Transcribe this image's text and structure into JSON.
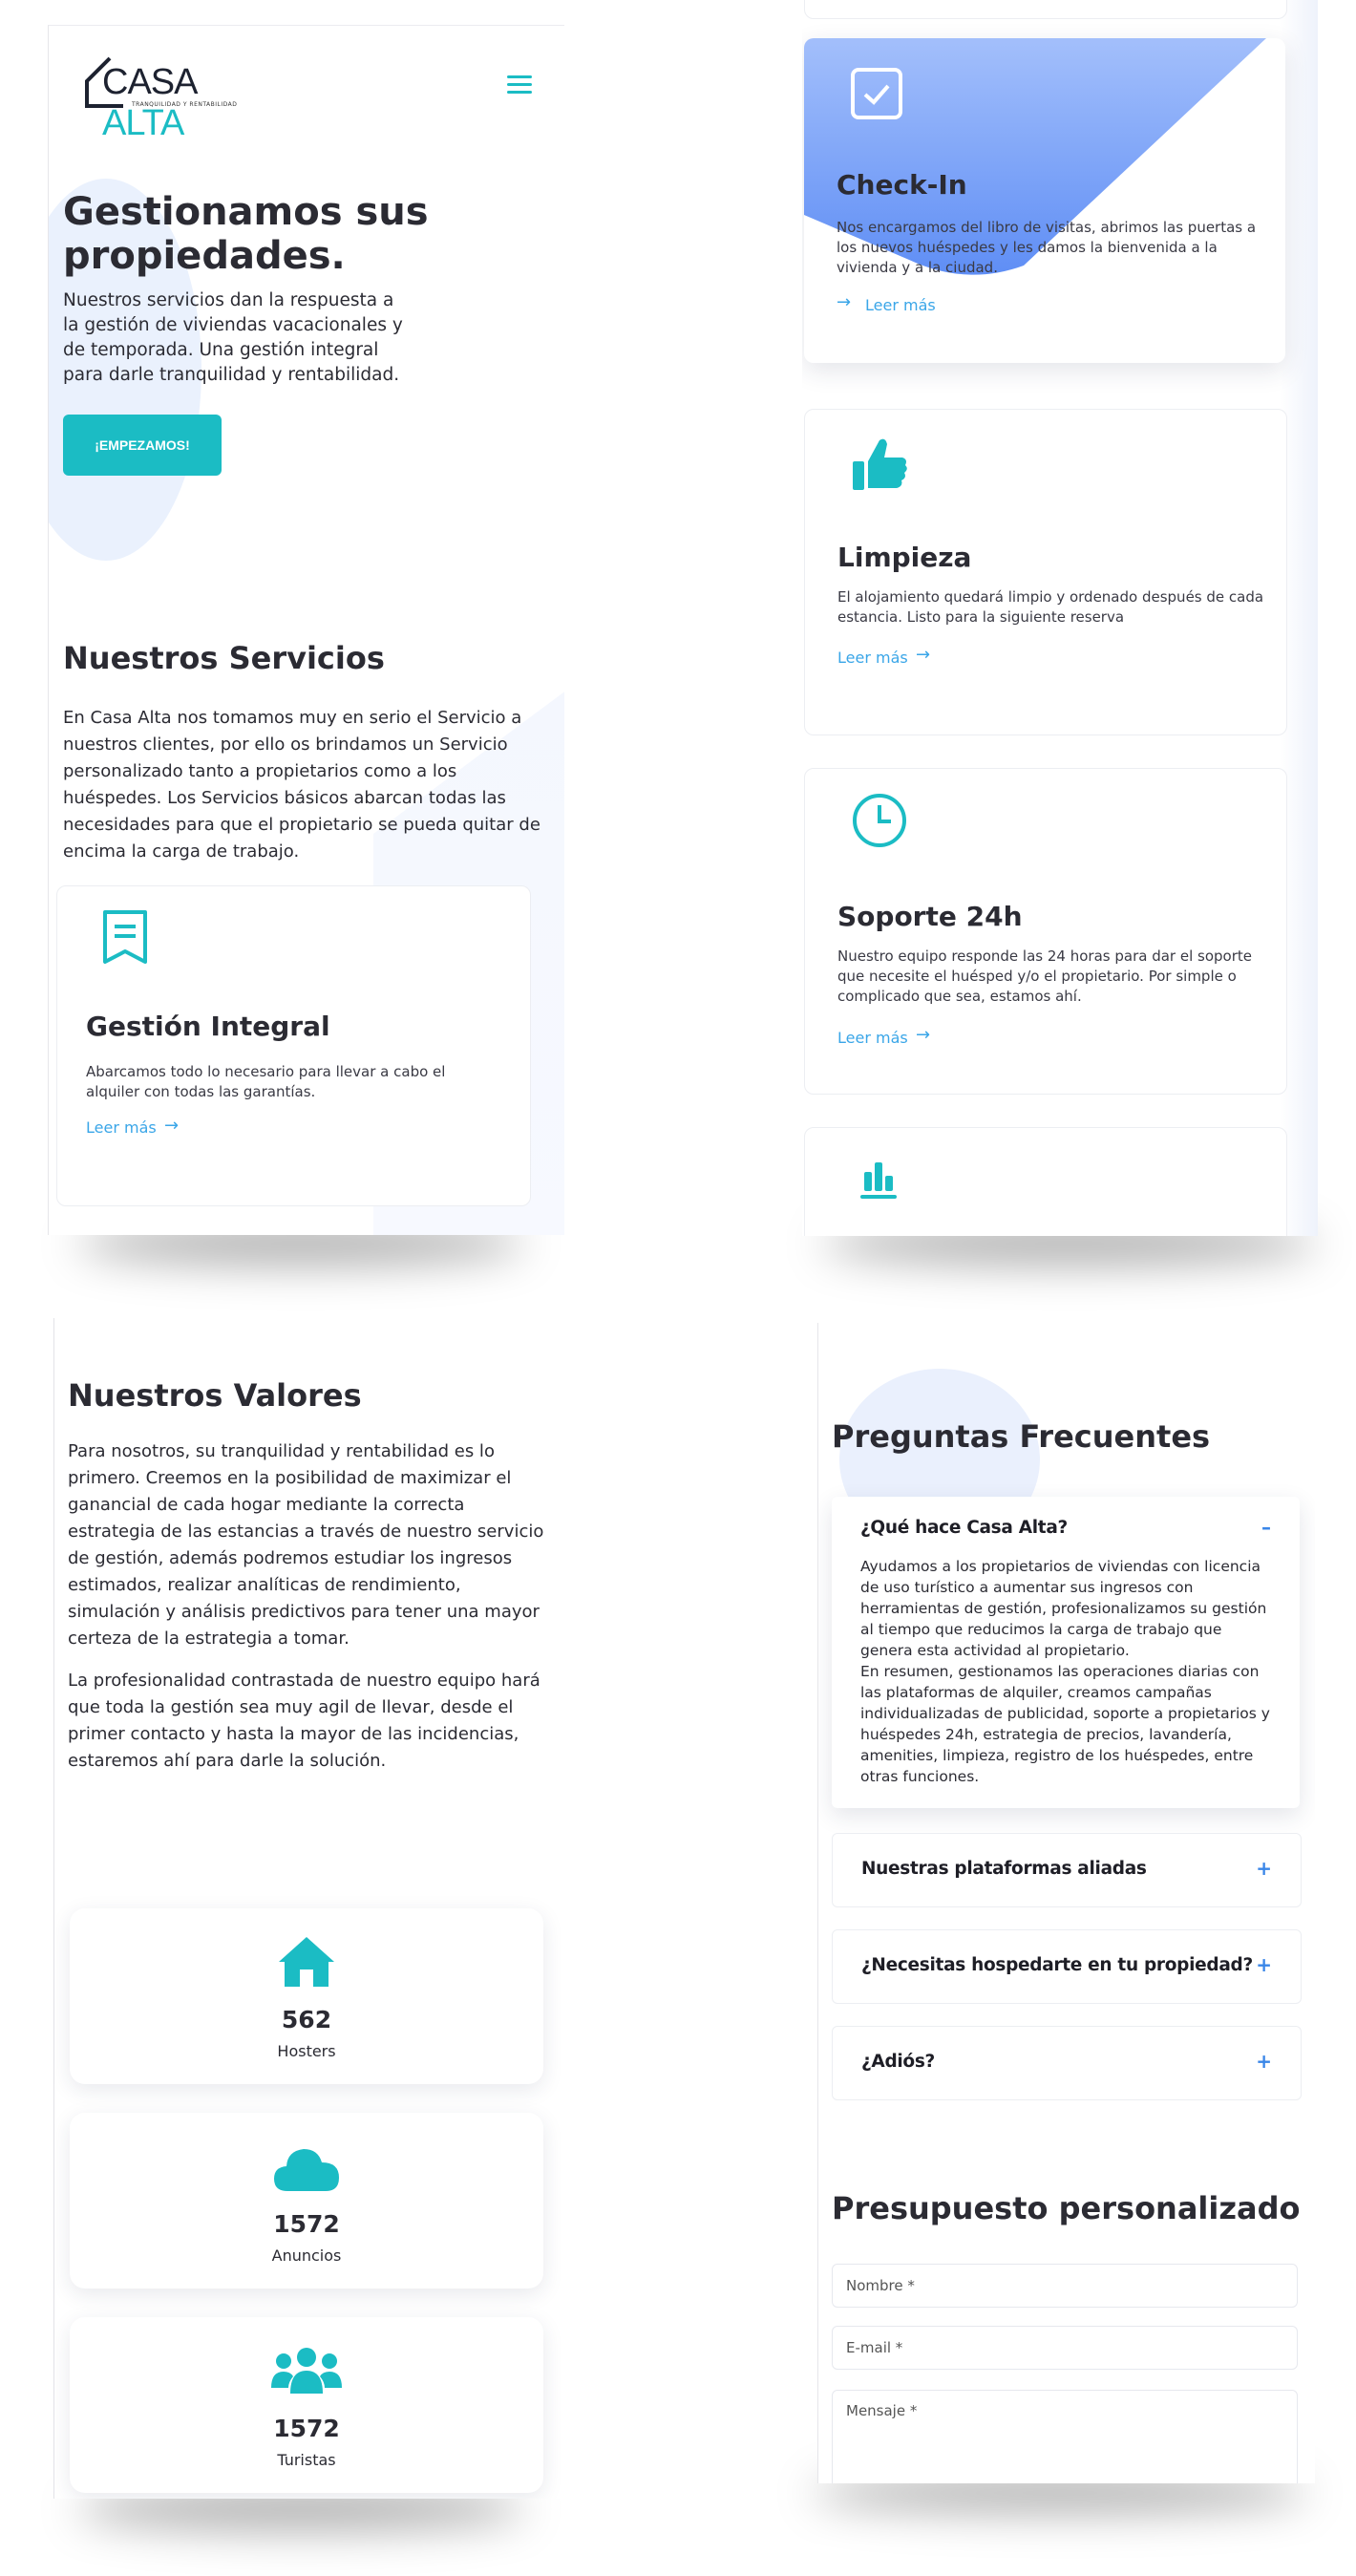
{
  "colors": {
    "accent": "#1bbcc4",
    "link": "#3aa6e8",
    "checkin_gradient": "#6e9cf6",
    "heading": "#2b2b33"
  },
  "header": {
    "logo_main": "CASA",
    "logo_accent": "ALTA",
    "logo_tagline": "TRANQUILIDAD Y RENTABILIDAD",
    "menu_icon": "hamburger-icon"
  },
  "hero": {
    "title": "Gestionamos sus propiedades.",
    "text": "Nuestros servicios dan la respuesta a la gestión de viviendas vacacionales y de temporada. Una gestión integral para darle tranquilidad y rentabilidad.",
    "cta": "¡EMPEZAMOS!"
  },
  "services": {
    "title": "Nuestros Servicios",
    "text": "En Casa Alta nos tomamos muy en serio el Servicio a nuestros clientes, por ello os brindamos un Servicio personalizado tanto a propietarios como a los huéspedes. Los Servicios básicos abarcan todas las necesidades para que el propietario se pueda quitar de encima la carga de trabajo.",
    "items": [
      {
        "icon": "document-icon",
        "title": "Gestión Integral",
        "desc": "Abarcamos todo lo necesario para llevar a cabo el alquiler con todas las garantías.",
        "link": "Leer más"
      },
      {
        "icon": "checkbox-icon",
        "title": "Check-In",
        "desc": "Nos encargamos del libro de visitas, abrimos las puertas a los nuevos huéspedes y les damos la bienvenida a la vivienda y a la ciudad.",
        "link": "Leer más"
      },
      {
        "icon": "thumbs-up-icon",
        "title": "Limpieza",
        "desc": "El alojamiento quedará limpio y ordenado después de cada estancia. Listo para la siguiente reserva",
        "link": "Leer más"
      },
      {
        "icon": "clock-icon",
        "title": "Soporte 24h",
        "desc": "Nuestro equipo responde las 24 horas para dar el soporte que necesite el huésped y/o el propietario. Por simple o complicado que sea, estamos ahí.",
        "link": "Leer más"
      },
      {
        "icon": "bar-chart-icon"
      }
    ]
  },
  "values": {
    "title": "Nuestros Valores",
    "p1": "Para nosotros, su tranquilidad y rentabilidad es lo primero. Creemos en la posibilidad de maximizar el ganancial de cada hogar mediante la correcta estrategia de las estancias a través de nuestro servicio de gestión, además podremos estudiar los ingresos estimados, realizar analíticas de rendimiento, simulación y análisis predictivos para tener una mayor certeza de la estrategia a tomar.",
    "p2": "La profesionalidad contrastada de nuestro equipo hará que toda la gestión sea muy agil de llevar, desde el primer contacto y hasta la mayor de las incidencias, estaremos ahí para darle la solución."
  },
  "stats": [
    {
      "icon": "house-icon",
      "value": "562",
      "label": "Hosters"
    },
    {
      "icon": "cloud-icon",
      "value": "1572",
      "label": "Anuncios"
    },
    {
      "icon": "users-icon",
      "value": "1572",
      "label": "Turistas"
    }
  ],
  "faq": {
    "title": "Preguntas Frecuentes",
    "items": [
      {
        "q": "¿Qué hace Casa Alta?",
        "sign": "–",
        "a1": "Ayudamos a los propietarios de viviendas con licencia de uso turístico a aumentar sus ingresos con herramientas de gestión, profesionalizamos su gestión al tiempo que reducimos la carga de trabajo que genera esta actividad al propietario.",
        "a2": "En resumen, gestionamos las operaciones diarias con las plataformas de alquiler, creamos campañas individualizadas de publicidad, soporte a propietarios y huéspedes 24h, estrategia de precios, lavandería, amenities, limpieza, registro de los huéspedes, entre otras funciones."
      },
      {
        "q": "Nuestras plataformas aliadas",
        "sign": "+"
      },
      {
        "q": "¿Necesitas hospedarte en tu propiedad?",
        "sign": "+"
      },
      {
        "q": "¿Adiós?",
        "sign": "+"
      }
    ]
  },
  "quote": {
    "title": "Presupuesto personalizado",
    "name_placeholder": "Nombre *",
    "email_placeholder": "E-mail *",
    "message_placeholder": "Mensaje *"
  }
}
